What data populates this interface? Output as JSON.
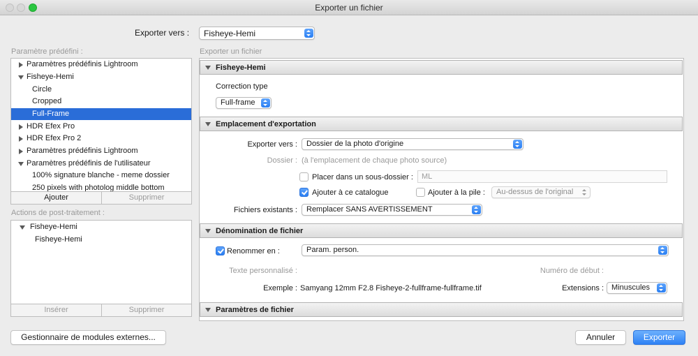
{
  "window": {
    "title": "Exporter un fichier"
  },
  "header": {
    "export_to_label": "Exporter vers :",
    "export_to_value": "Fisheye-Hemi"
  },
  "presets": {
    "section_label": "Paramètre prédéfini :",
    "items": [
      {
        "label": "Paramètres prédéfinis Lightroom",
        "expanded": false,
        "level": 0
      },
      {
        "label": "Fisheye-Hemi",
        "expanded": true,
        "level": 0
      },
      {
        "label": "Circle",
        "level": 1
      },
      {
        "label": "Cropped",
        "level": 1
      },
      {
        "label": "Full-Frame",
        "level": 1,
        "selected": true
      },
      {
        "label": "HDR Efex Pro",
        "expanded": false,
        "level": 0
      },
      {
        "label": "HDR Efex Pro 2",
        "expanded": false,
        "level": 0
      },
      {
        "label": "Paramètres prédéfinis Lightroom",
        "expanded": false,
        "level": 0
      },
      {
        "label": "Paramètres prédéfinis de l'utilisateur",
        "expanded": true,
        "level": 0
      },
      {
        "label": "100% signature blanche - meme dossier",
        "level": 1
      },
      {
        "label": "250 pixels with photolog middle bottom",
        "level": 1
      }
    ],
    "add_label": "Ajouter",
    "remove_label": "Supprimer"
  },
  "post_actions": {
    "section_label": "Actions de post-traitement :",
    "items": [
      {
        "label": "Fisheye-Hemi",
        "expanded": true
      },
      {
        "label": "Fisheye-Hemi"
      }
    ],
    "insert_label": "Insérer",
    "remove_label": "Supprimer"
  },
  "right": {
    "breadcrumb": "Exporter un fichier",
    "fisheye_section": {
      "title": "Fisheye-Hemi",
      "correction_label": "Correction type",
      "correction_value": "Full-frame"
    },
    "location_section": {
      "title": "Emplacement d'exportation",
      "export_to_label": "Exporter vers :",
      "export_to_value": "Dossier de la photo d'origine",
      "folder_label": "Dossier :",
      "folder_value": "(à l'emplacement de chaque photo source)",
      "subfolder_label": "Placer dans un sous-dossier :",
      "subfolder_placeholder": "ML",
      "add_catalog_label": "Ajouter à ce catalogue",
      "add_stack_label": "Ajouter à la pile :",
      "stack_value": "Au-dessus de l'original",
      "existing_files_label": "Fichiers existants :",
      "existing_files_value": "Remplacer SANS AVERTISSEMENT"
    },
    "naming_section": {
      "title": "Dénomination de fichier",
      "rename_label": "Renommer en :",
      "rename_value": "Param. person.",
      "custom_text_label": "Texte personnalisé :",
      "start_number_label": "Numéro de début :",
      "example_label": "Exemple :",
      "example_value": "Samyang 12mm F2.8 Fisheye-2-fullframe-fullframe.tif",
      "extensions_label": "Extensions :",
      "extensions_value": "Minuscules"
    },
    "file_settings_section": {
      "title": "Paramètres de fichier"
    }
  },
  "footer": {
    "plugin_manager_label": "Gestionnaire de modules externes...",
    "cancel_label": "Annuler",
    "export_label": "Exporter"
  },
  "colors": {
    "accent": "#2a7ff3",
    "selection": "#2a6dd8"
  }
}
